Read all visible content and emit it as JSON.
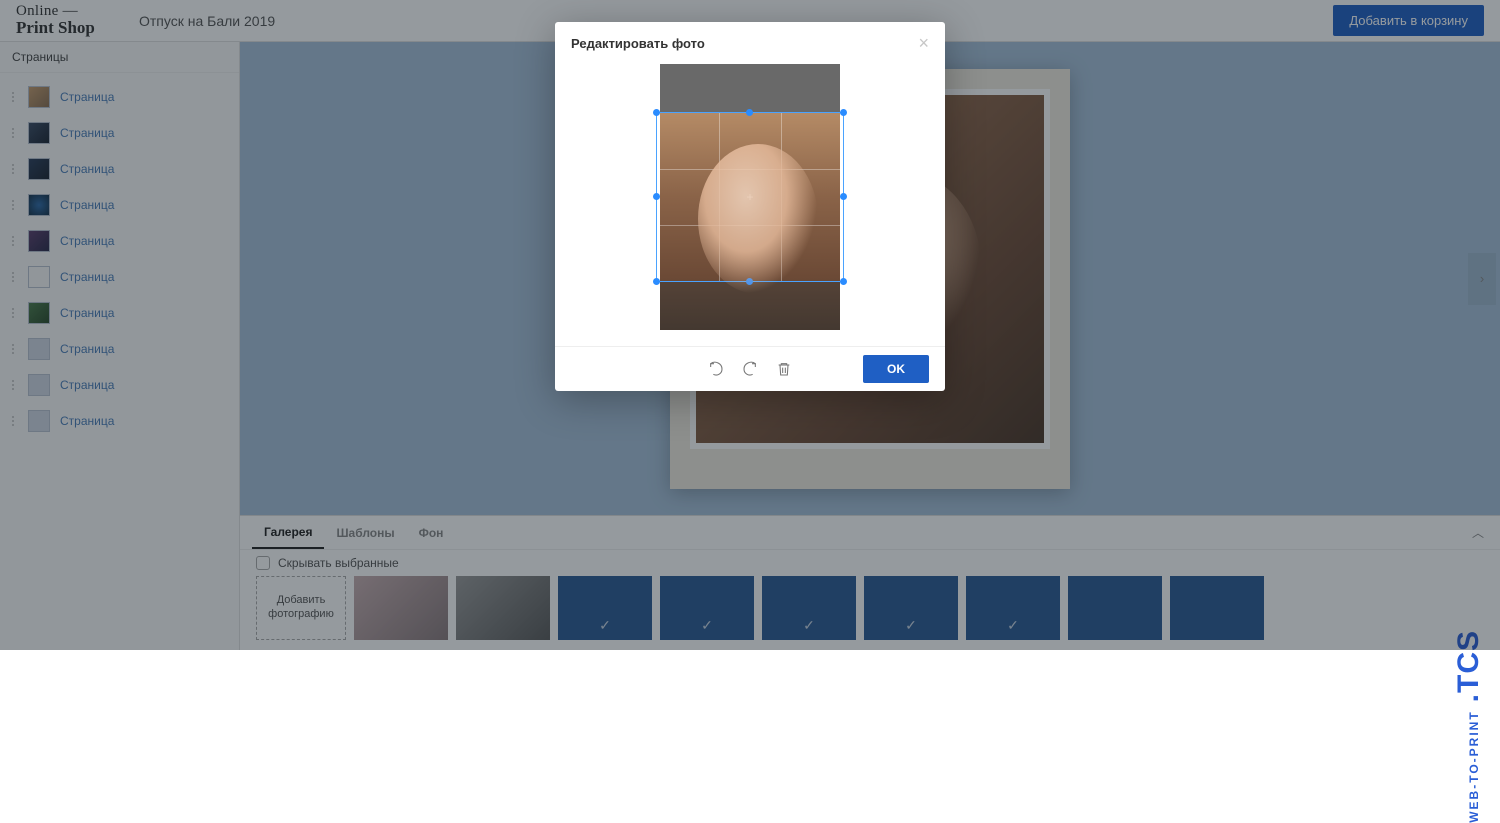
{
  "brand": {
    "line1": "Online —",
    "line2": "Print Shop"
  },
  "project_title": "Отпуск на Бали 2019",
  "add_to_cart": "Добавить в корзину",
  "sidebar": {
    "header": "Страницы",
    "item_label": "Страница"
  },
  "bottom": {
    "tabs": {
      "gallery": "Галерея",
      "templates": "Шаблоны",
      "background": "Фон"
    },
    "hide_selected": "Скрывать выбранные",
    "add_tile": "Добавить фотографию"
  },
  "modal": {
    "title": "Редактировать фото",
    "ok": "OK"
  },
  "side_brand": {
    "small": "WEB-TO-PRINT",
    "big": ".TCS"
  }
}
